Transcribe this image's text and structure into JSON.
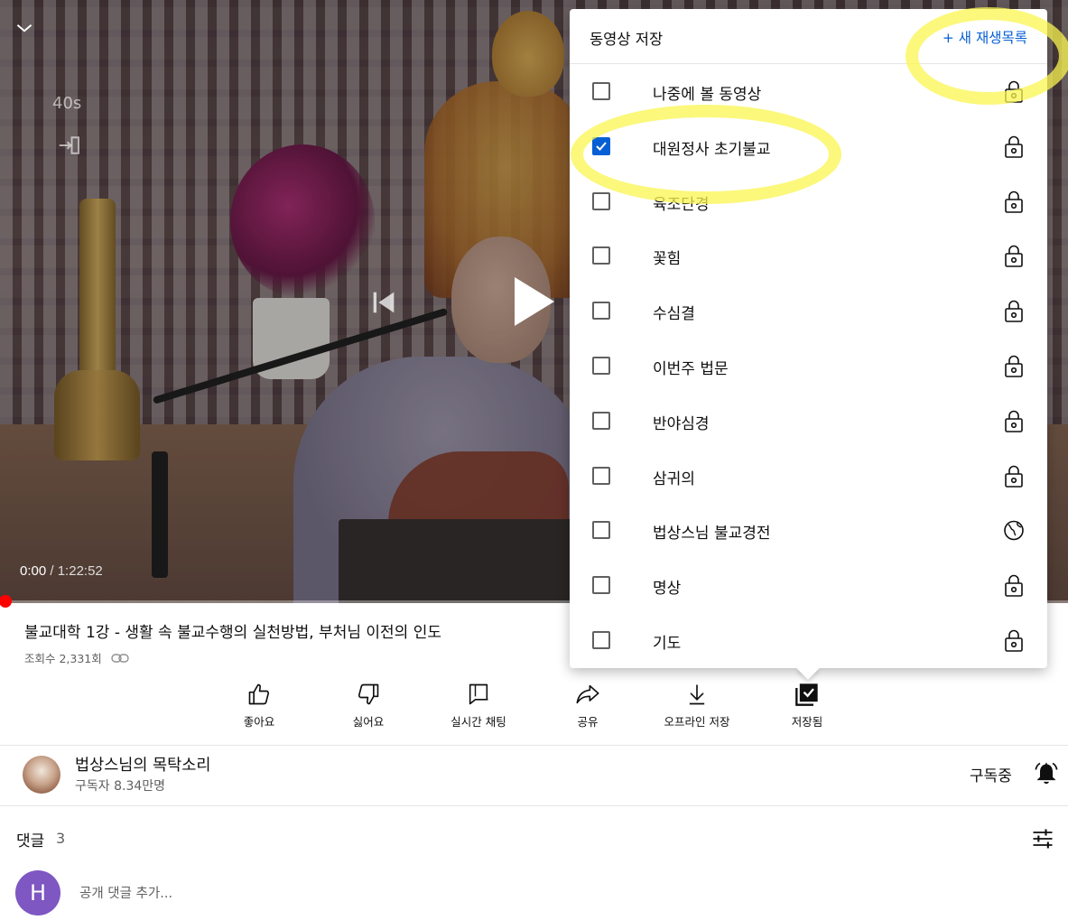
{
  "player": {
    "seek_hint": "40s",
    "current_time": "0:00",
    "separator": "/",
    "duration": "1:22:52",
    "progress_fraction": 0.0
  },
  "video": {
    "title": "불교대학 1강 - 생활 속 불교수행의 실천방법, 부처님 이전의 인도",
    "views": "조회수 2,331회"
  },
  "actions": [
    {
      "label": "좋아요",
      "icon": "thumb-up-icon"
    },
    {
      "label": "싫어요",
      "icon": "thumb-down-icon"
    },
    {
      "label": "실시간 채팅",
      "icon": "chat-icon"
    },
    {
      "label": "공유",
      "icon": "share-icon"
    },
    {
      "label": "오프라인 저장",
      "icon": "download-icon"
    },
    {
      "label": "저장됨",
      "icon": "saved-playlist-icon"
    }
  ],
  "channel": {
    "name": "법상스님의 목탁소리",
    "subscribers": "구독자 8.34만명",
    "subscribe_label": "구독중"
  },
  "comments": {
    "label": "댓글",
    "count": "3",
    "avatar_letter": "H",
    "placeholder": "공개 댓글 추가..."
  },
  "save_dialog": {
    "title": "동영상 저장",
    "new_playlist": "+ 새 재생목록",
    "playlists": [
      {
        "name": "나중에 볼 동영상",
        "checked": false,
        "privacy": "lock-icon"
      },
      {
        "name": "대원정사 초기불교",
        "checked": true,
        "privacy": "lock-icon"
      },
      {
        "name": "육조단경",
        "checked": false,
        "privacy": "lock-icon"
      },
      {
        "name": "꽃힘",
        "checked": false,
        "privacy": "lock-icon"
      },
      {
        "name": "수심결",
        "checked": false,
        "privacy": "lock-icon"
      },
      {
        "name": "이번주 법문",
        "checked": false,
        "privacy": "lock-icon"
      },
      {
        "name": "반야심경",
        "checked": false,
        "privacy": "lock-icon"
      },
      {
        "name": "삼귀의",
        "checked": false,
        "privacy": "lock-icon"
      },
      {
        "name": "법상스님 불교경전",
        "checked": false,
        "privacy": "globe-icon"
      },
      {
        "name": "명상",
        "checked": false,
        "privacy": "lock-icon"
      },
      {
        "name": "기도",
        "checked": false,
        "privacy": "lock-icon"
      }
    ]
  },
  "colors": {
    "accent_blue": "#065fd4",
    "progress_red": "#ff0000",
    "highlight_yellow": "#faf550",
    "avatar_purple": "#7e57c2"
  }
}
